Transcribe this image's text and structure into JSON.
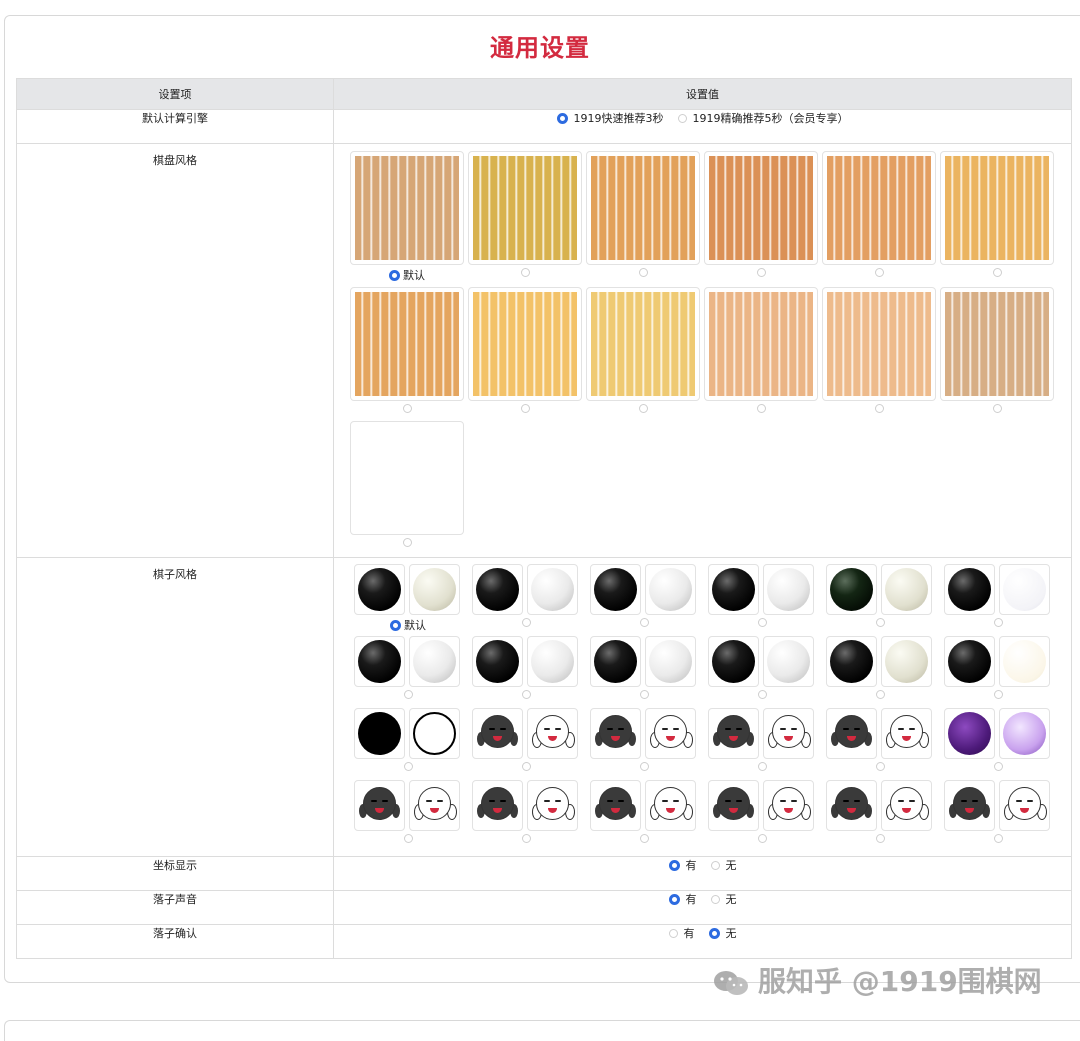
{
  "page": {
    "title": "通用设置"
  },
  "table": {
    "header": {
      "col_item": "设置项",
      "col_value": "设置值"
    },
    "engine": {
      "label": "默认计算引擎",
      "options": [
        {
          "label": "1919快速推荐3秒",
          "selected": true
        },
        {
          "label": "1919精确推荐5秒（会员专享）",
          "selected": false
        }
      ]
    },
    "board_style": {
      "label": "棋盘风格",
      "default_label": "默认",
      "swatches": [
        {
          "color": "#d6a676",
          "selected": true
        },
        {
          "color": "#d8b24e",
          "selected": false
        },
        {
          "color": "#e2a15a",
          "selected": false
        },
        {
          "color": "#db9156",
          "selected": false
        },
        {
          "color": "#e39f62",
          "selected": false
        },
        {
          "color": "#ebb460",
          "selected": false
        },
        {
          "color": "#e4a55f",
          "selected": false
        },
        {
          "color": "#f3c268",
          "selected": false
        },
        {
          "color": "#efca73",
          "selected": false
        },
        {
          "color": "#ebb586",
          "selected": false
        },
        {
          "color": "#eebb8c",
          "selected": false
        },
        {
          "color": "#d7ae85",
          "selected": false
        },
        {
          "color": "#ffffff",
          "selected": false
        }
      ]
    },
    "stone_style": {
      "label": "棋子风格",
      "default_label": "默认",
      "pairs": [
        {
          "black": "blk",
          "white": "wht2",
          "selected": true
        },
        {
          "black": "blk",
          "white": "wht",
          "selected": false
        },
        {
          "black": "blk",
          "white": "wht",
          "selected": false
        },
        {
          "black": "blk",
          "white": "wht",
          "selected": false
        },
        {
          "black": "grn",
          "white": "wht2",
          "selected": false
        },
        {
          "black": "blk",
          "white": "wht3",
          "selected": false
        },
        {
          "black": "blk",
          "white": "wht",
          "selected": false
        },
        {
          "black": "blk",
          "white": "wht",
          "selected": false
        },
        {
          "black": "blk",
          "white": "wht",
          "selected": false
        },
        {
          "black": "blk",
          "white": "wht",
          "selected": false
        },
        {
          "black": "blk",
          "white": "wht2",
          "selected": false
        },
        {
          "black": "blk",
          "white": "wht4",
          "selected": false
        },
        {
          "black": "flatb",
          "white": "flatw",
          "selected": false
        },
        {
          "black": "face-dark",
          "white": "face-light",
          "selected": false
        },
        {
          "black": "face-dark",
          "white": "face-light",
          "selected": false
        },
        {
          "black": "face-dark",
          "white": "face-light",
          "selected": false
        },
        {
          "black": "face-dark",
          "white": "face-light",
          "selected": false
        },
        {
          "black": "purp",
          "white": "purpw",
          "selected": false
        },
        {
          "black": "face-dark",
          "white": "face-light",
          "selected": false
        },
        {
          "black": "face-dark",
          "white": "face-light",
          "selected": false
        },
        {
          "black": "face-dark",
          "white": "face-light",
          "selected": false
        },
        {
          "black": "face-dark",
          "white": "face-light",
          "selected": false
        },
        {
          "black": "face-dark",
          "white": "face-light",
          "selected": false
        },
        {
          "black": "face-dark",
          "white": "face-light",
          "selected": false
        }
      ]
    },
    "coords": {
      "label": "坐标显示",
      "options": [
        {
          "label": "有",
          "selected": true
        },
        {
          "label": "无",
          "selected": false
        }
      ]
    },
    "sound": {
      "label": "落子声音",
      "options": [
        {
          "label": "有",
          "selected": true
        },
        {
          "label": "无",
          "selected": false
        }
      ]
    },
    "confirm": {
      "label": "落子确认",
      "options": [
        {
          "label": "有",
          "selected": false
        },
        {
          "label": "无",
          "selected": true
        }
      ]
    }
  },
  "watermark": {
    "text": "服知乎 @1919围棋网"
  },
  "colors": {
    "accent": "#d32a3f",
    "radio_on": "#2d6be0",
    "header_bg": "#e5e6e8"
  }
}
